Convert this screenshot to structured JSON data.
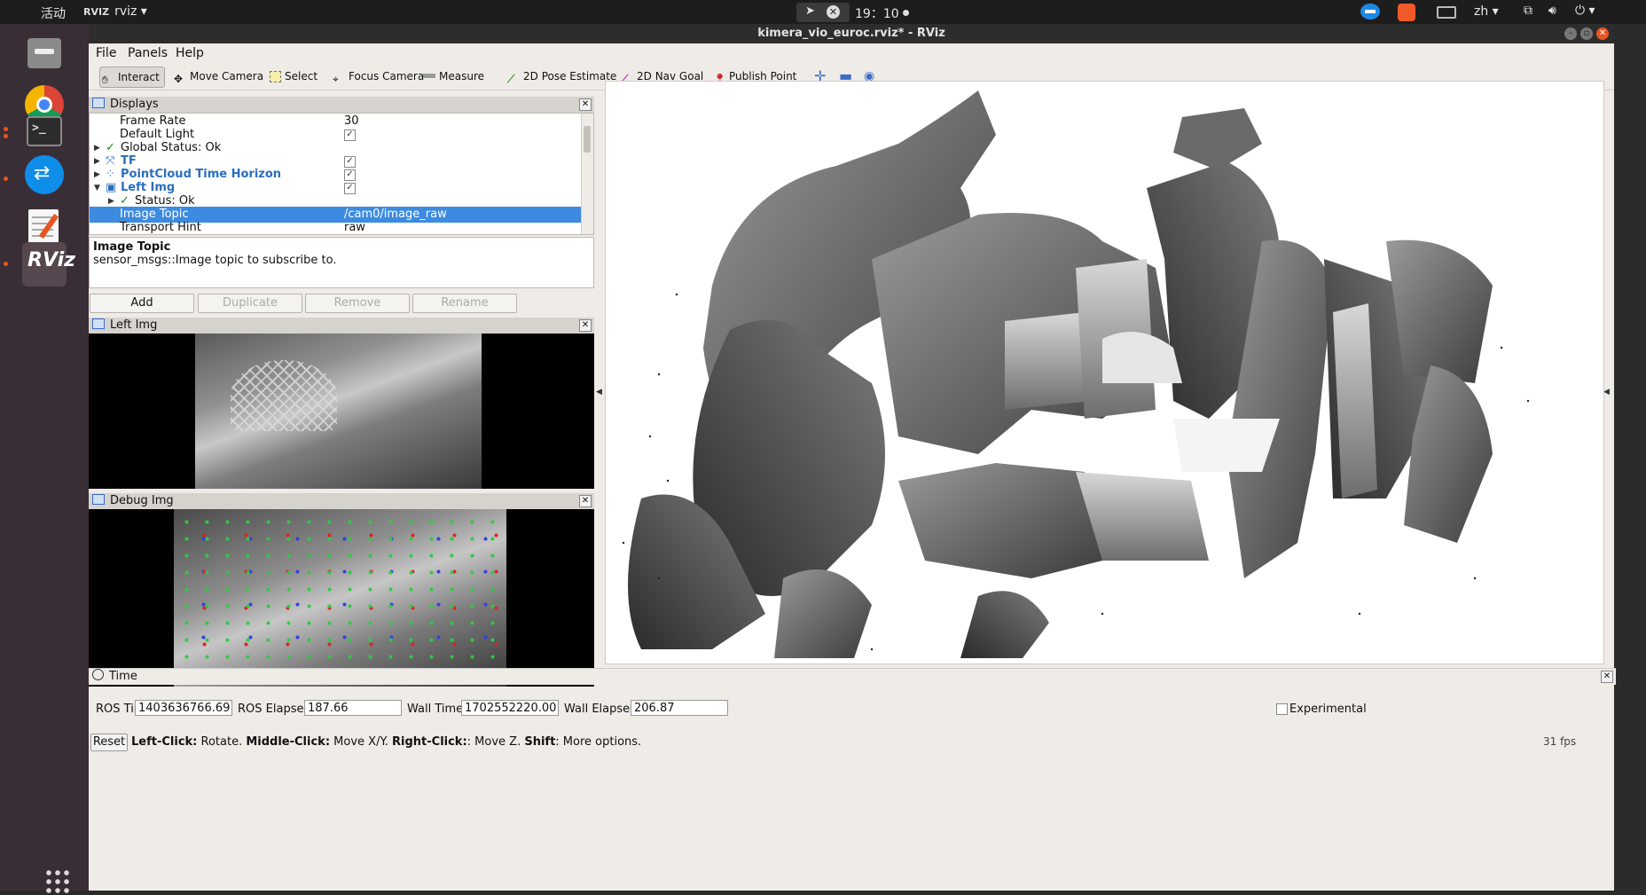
{
  "topbar": {
    "activities": "活动",
    "app_icon": "RVIZ",
    "app_name": "rviz ▾",
    "clock": "19：10",
    "lang": "zh ▾"
  },
  "dock": {
    "items": [
      "files-icon",
      "chrome-icon",
      "terminal-icon",
      "teamviewer-icon",
      "text-editor-icon",
      "rviz-icon"
    ],
    "rviz_label": "RViz",
    "terminal_glyph": ">_"
  },
  "window": {
    "title": "kimera_vio_euroc.rviz* - RViz"
  },
  "menubar": {
    "file": "File",
    "panels": "Panels",
    "help": "Help"
  },
  "toolbar": {
    "interact": "Interact",
    "move_camera": "Move Camera",
    "select": "Select",
    "focus_camera": "Focus Camera",
    "measure": "Measure",
    "pose_estimate": "2D Pose Estimate",
    "nav_goal": "2D Nav Goal",
    "publish_point": "Publish Point",
    "plus": "✛",
    "minus": "▬",
    "camera": "◉"
  },
  "displays": {
    "title": "Displays",
    "rows": [
      {
        "label": "Frame Rate",
        "value": "30"
      },
      {
        "label": "Default Light",
        "checked": true
      },
      {
        "label": "Global Status: Ok"
      },
      {
        "label": "TF",
        "checked": true
      },
      {
        "label": "PointCloud Time Horizon",
        "checked": true
      },
      {
        "label": "Left Img",
        "checked": true
      },
      {
        "label": "Status: Ok"
      },
      {
        "label": "Image Topic",
        "value": "/cam0/image_raw"
      },
      {
        "label": "Transport Hint",
        "value": "raw"
      }
    ],
    "description_title": "Image Topic",
    "description_text": "sensor_msgs::Image topic to subscribe to.",
    "buttons": {
      "add": "Add",
      "duplicate": "Duplicate",
      "remove": "Remove",
      "rename": "Rename"
    }
  },
  "panels": {
    "left_img": "Left Img",
    "debug_img": "Debug Img"
  },
  "time": {
    "title": "Time",
    "ros_time_label": "ROS Time:",
    "ros_time": "1403636766.69",
    "ros_elapsed_label": "ROS Elapsed:",
    "ros_elapsed": "187.66",
    "wall_time_label": "Wall Time:",
    "wall_time": "1702552220.00",
    "wall_elapsed_label": "Wall Elapsed:",
    "wall_elapsed": "206.87",
    "experimental_label": "Experimental",
    "experimental_checked": false
  },
  "status": {
    "reset": "Reset",
    "hint_left_key": "Left-Click:",
    "hint_left": " Rotate. ",
    "hint_middle_key": "Middle-Click:",
    "hint_middle": " Move X/Y. ",
    "hint_right_key": "Right-Click:",
    "hint_right": ": Move Z. ",
    "hint_shift_key": "Shift",
    "hint_shift": ": More options.",
    "fps": "31 fps"
  },
  "colors": {
    "selection": "#3d8be0",
    "ok_green": "#1a8a1a",
    "display_blue": "#2a6fbf",
    "ubuntu_orange": "#e95420"
  }
}
